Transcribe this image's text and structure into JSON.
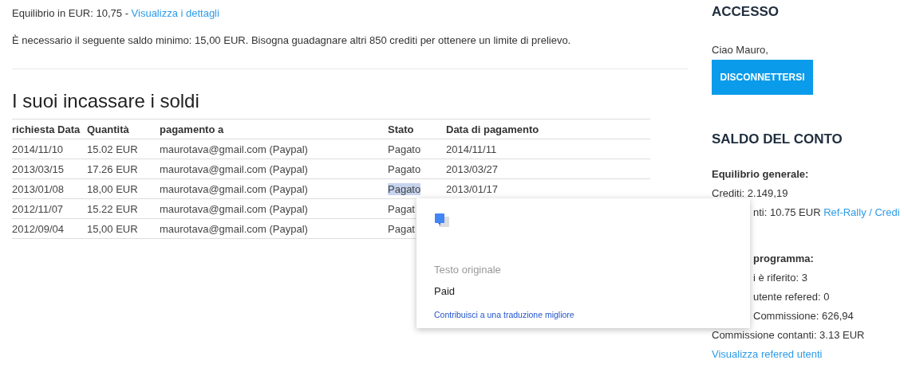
{
  "balance": {
    "text": "Equilibrio in EUR: 10,75 - ",
    "link": "Visualizza i dettagli"
  },
  "notice": "È necessario il seguente saldo minimo: 15,00 EUR. Bisogna guadagnare altri 850 crediti per ottenere un limite di prelievo.",
  "heading": "I suoi incassare i soldi",
  "table": {
    "columns": [
      "richiesta Data",
      "Quantità",
      "pagamento a",
      "Stato",
      "Data di pagamento"
    ],
    "rows": [
      {
        "cells": [
          "2014/11/10",
          "15.02 EUR",
          "maurotava@gmail.com (Paypal)",
          "Pagato",
          "2014/11/11"
        ],
        "highlighted": false
      },
      {
        "cells": [
          "2013/03/15",
          "17.26 EUR",
          "maurotava@gmail.com (Paypal)",
          "Pagato",
          "2013/03/27"
        ],
        "highlighted": false
      },
      {
        "cells": [
          "2013/01/08",
          "18,00 EUR",
          "maurotava@gmail.com (Paypal)",
          "Pagato",
          "2013/01/17"
        ],
        "highlighted": true
      },
      {
        "cells": [
          "2012/11/07",
          "15.22 EUR",
          "maurotava@gmail.com (Paypal)",
          "Pagat"
        ],
        "highlighted": false
      },
      {
        "cells": [
          "2012/09/04",
          "15,00 EUR",
          "maurotava@gmail.com (Paypal)",
          "Pagat"
        ],
        "highlighted": false
      }
    ]
  },
  "sidebar": {
    "login_title": "ACCESSO",
    "greeting": "Ciao Mauro,",
    "logout_button": "DISCONNETTERSI",
    "balance_title": "SALDO DEL CONTO",
    "lines": [
      {
        "kind": "bold",
        "text": "Equilibrio generale:",
        "covered": false
      },
      {
        "kind": "text",
        "text": "Crediti: 2.149,19",
        "covered": false
      },
      {
        "kind": "text",
        "text": "nti: 10.75 EUR",
        "link": "Ref-Rally / Credi",
        "covered": true
      },
      {
        "kind": "gap"
      },
      {
        "kind": "bold",
        "text": "programma:",
        "covered": true
      },
      {
        "kind": "text",
        "text": "i è riferito: 3",
        "covered": true
      },
      {
        "kind": "text",
        "text": "utente refered: 0",
        "covered": true
      },
      {
        "kind": "text",
        "text": "Commissione: 626,94",
        "covered": true
      },
      {
        "kind": "text",
        "text": "Commissione contanti: 3.13 EUR",
        "covered": false
      },
      {
        "kind": "link",
        "text": "Visualizza refered utenti",
        "covered": false
      }
    ]
  },
  "translate_popup": {
    "label": "Testo originale",
    "original": "Paid",
    "link": "Contribuisci a una traduzione migliore"
  }
}
